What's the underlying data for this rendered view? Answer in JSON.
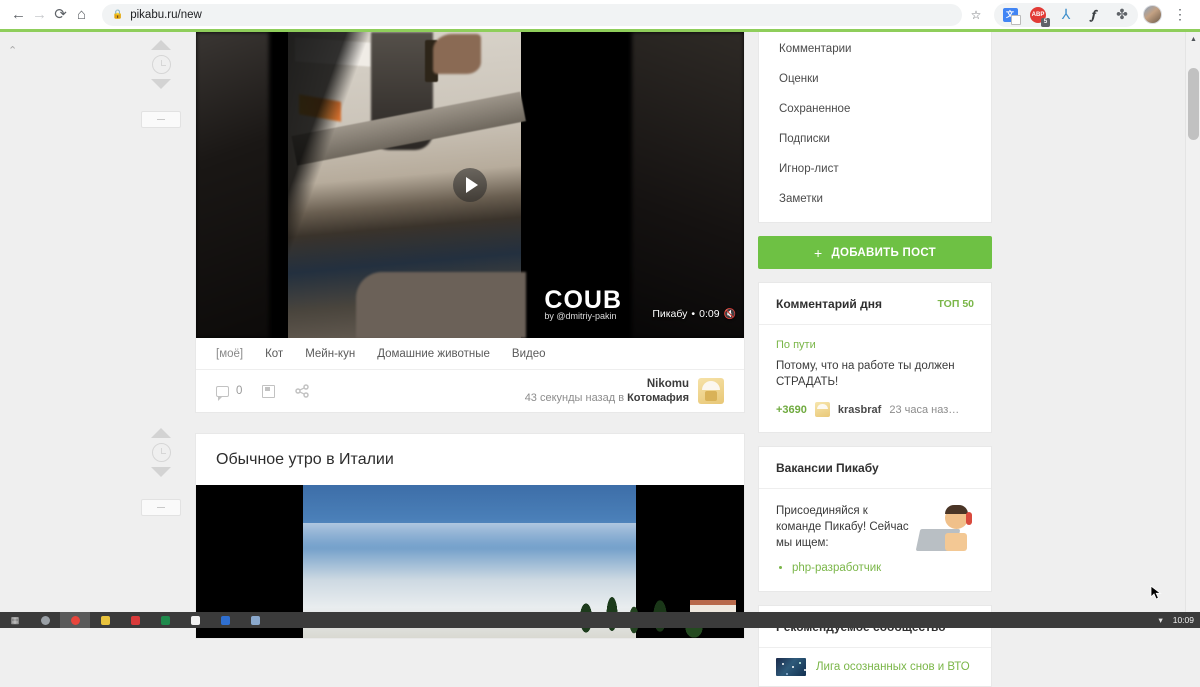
{
  "browser": {
    "url": "pikabu.ru/new",
    "lock_icon": "lock-icon",
    "back_icon": "←",
    "forward_icon": "→",
    "reload_icon": "⟳",
    "home_icon": "⌂",
    "star_icon": "☆",
    "menu_icon": "⋮",
    "extensions": [
      {
        "name": "translate-extension-icon",
        "glyph": "文"
      },
      {
        "name": "adblock-extension-icon",
        "glyph": "ABP"
      },
      {
        "name": "acrobat-extension-icon",
        "glyph": "⅄"
      },
      {
        "name": "lightning-extension-icon",
        "glyph": "⚡"
      },
      {
        "name": "puzzle-extensions-icon",
        "glyph": "🧩"
      }
    ]
  },
  "feed": {
    "posts": [
      {
        "title": "",
        "video": {
          "watermark_brand": "COUB",
          "watermark_author": "by @dmitriy-pakin",
          "source_label": "Пикабу",
          "separator": "•",
          "duration": "0:09",
          "mute_icon": "muted-speaker-icon"
        },
        "tags": [
          "[моё]",
          "Кот",
          "Мейн-кун",
          "Домашние животные",
          "Видео"
        ],
        "actions": {
          "comments_count": "0",
          "comments_icon": "comment-icon",
          "save_icon": "save-icon",
          "share_icon": "share-icon"
        },
        "author": {
          "name": "Nikomu",
          "time": "43 секунды назад в ",
          "community": "Котомафия"
        },
        "rating": {
          "up_icon": "upvote-arrow-icon",
          "clock_icon": "clock-pending-icon",
          "down_icon": "downvote-arrow-icon",
          "collapse_icon": "collapse-post-icon"
        }
      },
      {
        "title": "Обычное утро в Италии",
        "rating": {
          "up_icon": "upvote-arrow-icon",
          "clock_icon": "clock-pending-icon",
          "down_icon": "downvote-arrow-icon",
          "collapse_icon": "collapse-post-icon"
        }
      }
    ],
    "top_collapse_icon": "scroll-to-top-icon"
  },
  "sidebar": {
    "menu": [
      {
        "label": "Комментарии"
      },
      {
        "label": "Оценки"
      },
      {
        "label": "Сохраненное"
      },
      {
        "label": "Подписки"
      },
      {
        "label": "Игнор-лист"
      },
      {
        "label": "Заметки"
      }
    ],
    "add_post": {
      "plus": "+",
      "label": "ДОБАВИТЬ ПОСТ"
    },
    "comment_of_day": {
      "title": "Комментарий дня",
      "badge": "ТОП 50",
      "source": "По пути",
      "text": "Потому, что на работе ты должен СТРАДАТЬ!",
      "score": "+3690",
      "user": "krasbraf",
      "time": "23 часа наз…"
    },
    "vacancies": {
      "title": "Вакансии Пикабу",
      "text": "Присоединяйся к команде Пикабу! Сейчас мы ищем:",
      "items": [
        "php-разработчик"
      ]
    },
    "recommended": {
      "title": "Рекомендуемое сообщество",
      "community": "Лига осознанных снов и ВТО"
    }
  },
  "taskbar": {
    "start_icon": "start-menu-icon",
    "clock": "10:09",
    "tray_icon": "show-hidden-icons-icon"
  },
  "colors": {
    "accent_green": "#6ec144",
    "link_green": "#7ab648",
    "page_bg": "#efefef"
  }
}
